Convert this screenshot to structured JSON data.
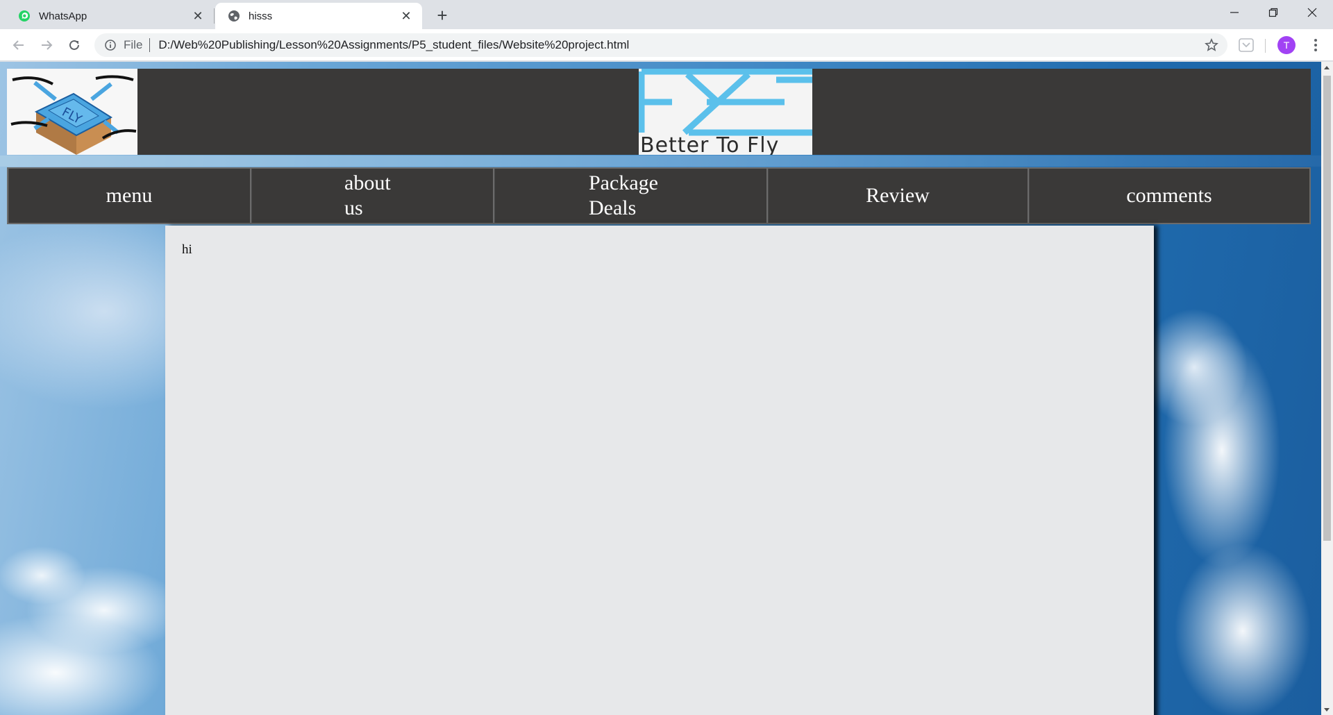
{
  "browser": {
    "tabs": [
      {
        "title": "WhatsApp",
        "icon": "whatsapp-icon",
        "active": false
      },
      {
        "title": "hisss",
        "icon": "globe-icon",
        "active": true
      }
    ],
    "new_tab_label": "+",
    "omnibox": {
      "scheme_label": "File",
      "url": "D:/Web%20Publishing/Lesson%20Assignments/P5_student_files/Website%20project.html"
    },
    "profile_initial": "T",
    "colors": {
      "tab_strip": "#dee1e6",
      "avatar": "#a142f4",
      "whatsapp": "#25d366"
    }
  },
  "page": {
    "header": {
      "left_logo": "drone-box-logo",
      "center_logo": "fly-logo",
      "brand_text": "Better To Fly",
      "colors": {
        "bar": "#3a3938",
        "logo_blue": "#5bc0eb"
      }
    },
    "nav": {
      "items": [
        {
          "label": "menu"
        },
        {
          "label": "about us"
        },
        {
          "label": "Package Deals"
        },
        {
          "label": "Review"
        },
        {
          "label": "comments"
        }
      ]
    },
    "content": {
      "text": "hi",
      "background": "#e7e8ea"
    }
  }
}
